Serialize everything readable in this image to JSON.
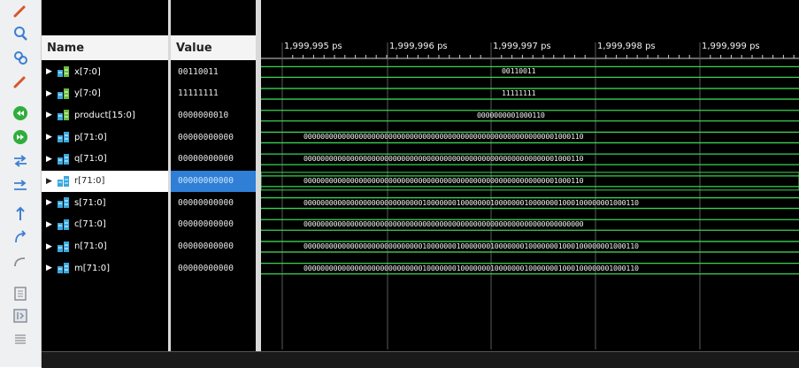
{
  "toolbar": {
    "tools": [
      {
        "name": "zoom-fit-icon",
        "color": "#d8532b"
      },
      {
        "name": "zoom-in-icon",
        "color": "#3d7fd1"
      },
      {
        "name": "zoom-out-icon",
        "color": "#3d7fd1"
      },
      {
        "name": "marker-icon",
        "color": "#d8532b"
      },
      {
        "name": "go-to-start-icon",
        "color": "#2fae3b"
      },
      {
        "name": "go-to-end-icon",
        "color": "#2fae3b"
      },
      {
        "name": "swap-icon",
        "color": "#3d7fd1"
      },
      {
        "name": "add-marker-icon",
        "color": "#3d7fd1"
      },
      {
        "name": "previous-transition-icon",
        "color": "#3d7fd1"
      },
      {
        "name": "next-transition-icon",
        "color": "#3d7fd1"
      },
      {
        "name": "snap-icon",
        "color": "#8a8f96"
      },
      {
        "name": "layout-icon",
        "color": "#8a8f96"
      },
      {
        "name": "float-icon",
        "color": "#8a8f96"
      },
      {
        "name": "list-icon",
        "color": "#8a8f96"
      }
    ]
  },
  "columns": {
    "name": "Name",
    "value": "Value"
  },
  "ruler": {
    "ticks": [
      "1,999,995 ps",
      "1,999,996 ps",
      "1,999,997 ps",
      "1,999,998 ps",
      "1,999,999 ps"
    ]
  },
  "signals": [
    {
      "name": "x[7:0]",
      "value": "00110011",
      "wave": "00110011",
      "selected": false
    },
    {
      "name": "y[7:0]",
      "value": "11111111",
      "wave": "11111111",
      "selected": false
    },
    {
      "name": "product[15:0]",
      "value": "0000000010",
      "wave": "0000000001000110",
      "selected": false
    },
    {
      "name": "p[71:0]",
      "value": "00000000000",
      "wave": "000000000000000000000000000000000000000000000000000000000001000110",
      "selected": false
    },
    {
      "name": "q[71:0]",
      "value": "00000000000",
      "wave": "000000000000000000000000000000000000000000000000000000000001000110",
      "selected": false
    },
    {
      "name": "r[71:0]",
      "value": "00000000000",
      "wave": "000000000000000000000000000000000000000000000000000000000001000110",
      "selected": true
    },
    {
      "name": "s[71:0]",
      "value": "00000000000",
      "wave": "0000000000000000000000000000100000001000000010000000100000001000100000001000110",
      "selected": false
    },
    {
      "name": "c[71:0]",
      "value": "00000000000",
      "wave": "000000000000000000000000000000000000000000000000000000000000000000",
      "selected": false
    },
    {
      "name": "n[71:0]",
      "value": "00000000000",
      "wave": "0000000000000000000000000000100000001000000010000000100000001000100000001000110",
      "selected": false
    },
    {
      "name": "m[71:0]",
      "value": "00000000000",
      "wave": "0000000000000000000000000000100000001000000010000000100000001000100000001000110",
      "selected": false
    }
  ],
  "colors": {
    "wave": "#39d353",
    "selected_row": "#ffffff",
    "selected_value": "#2f7fd6",
    "grid": "#5a5a5a"
  }
}
